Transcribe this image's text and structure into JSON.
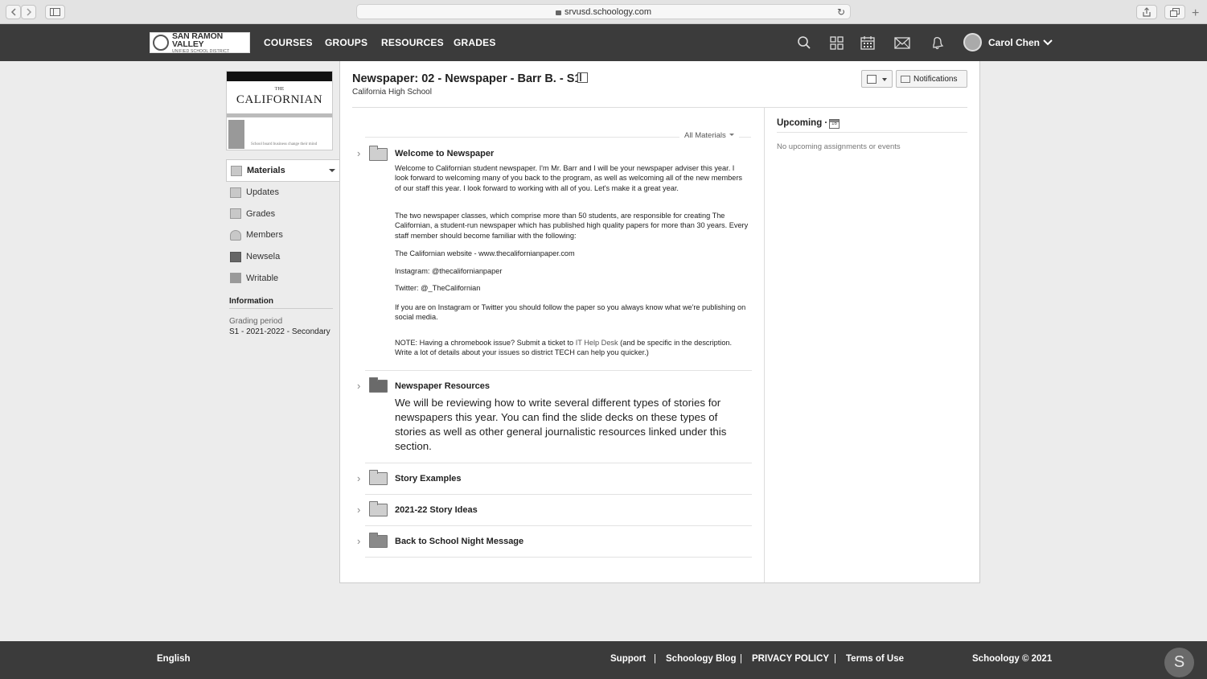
{
  "browser": {
    "url": "srvusd.schoology.com"
  },
  "header": {
    "logo_main": "SAN RAMON VALLEY",
    "logo_sub": "UNIFIED SCHOOL DISTRICT",
    "nav": [
      "COURSES",
      "GROUPS",
      "RESOURCES",
      "GRADES"
    ],
    "user_name": "Carol Chen"
  },
  "course_image": {
    "the": "THE",
    "title": "CALIFORNIAN",
    "caption": "School board business change their mind"
  },
  "sidebar": {
    "items": [
      {
        "label": "Materials",
        "icon": "materials-icon"
      },
      {
        "label": "Updates",
        "icon": "updates-icon"
      },
      {
        "label": "Grades",
        "icon": "grades-icon"
      },
      {
        "label": "Members",
        "icon": "members-icon"
      },
      {
        "label": "Newsela",
        "icon": "newsela-icon"
      },
      {
        "label": "Writable",
        "icon": "writable-icon"
      }
    ],
    "info_heading": "Information",
    "grading_label": "Grading period",
    "grading_value": "S1 - 2021-2022 - Secondary"
  },
  "page": {
    "title": "Newspaper: 02 - Newspaper - Barr B. - S1",
    "school": "California High School",
    "notifications_label": "Notifications",
    "filter_label": "All Materials"
  },
  "materials": [
    {
      "title": "Welcome to Newspaper",
      "p1": "Welcome to Californian student newspaper. I'm Mr. Barr and I will be your newspaper adviser this year. I look forward to welcoming many of you back to the program, as well as welcoming all of the new members of our staff this year.  I look forward to working with all of you. Let's make it a great year.",
      "p2": "The two newspaper classes, which comprise more than 50 students, are responsible for creating The Californian, a student-run newspaper which has published high quality papers for more than 30 years. Every staff member should become familiar with the following:",
      "p3": "The Californian website - www.thecalifornianpaper.com",
      "p4": "Instagram: @thecalifornianpaper",
      "p5": "Twitter: @_TheCalifornian",
      "p6": "If you are on Instagram or Twitter you should follow the paper so you always know what we're publishing on social media.",
      "p7a": "NOTE: Having a chromebook issue?  Submit a ticket to ",
      "p7link": "IT Help Desk",
      "p7b": " (and be specific in the description.  Write a lot of details about your issues so district TECH can help you quicker.)"
    },
    {
      "title": "Newspaper Resources",
      "body": "We will be reviewing how to write several different types of stories for newspapers this year. You can find the slide decks on these types of stories as well as other general journalistic resources linked under this section."
    },
    {
      "title": "Story Examples"
    },
    {
      "title": "2021-22 Story Ideas"
    },
    {
      "title": "Back to School Night Message"
    }
  ],
  "upcoming": {
    "title": "Upcoming",
    "cal_day": "16",
    "empty": "No upcoming assignments or events"
  },
  "footer": {
    "language": "English",
    "links": [
      "Support",
      "Schoology Blog",
      "PRIVACY POLICY",
      "Terms of Use"
    ],
    "separator": "|",
    "copyright": "Schoology © 2021",
    "chat_letter": "S"
  }
}
